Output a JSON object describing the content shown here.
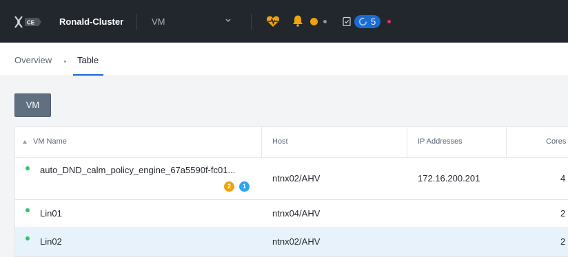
{
  "header": {
    "logo_text": "CE",
    "cluster_name": "Ronald-Cluster",
    "entity_selector": "VM",
    "task_count": "5",
    "colors": {
      "background": "#22272e",
      "health": "#f0a30a",
      "alert": "#f0a30a",
      "task_pill": "#1b6bd3",
      "error_dot": "#e0355a"
    }
  },
  "tabs": [
    {
      "label": "Overview",
      "active": false
    },
    {
      "label": "Table",
      "active": true
    }
  ],
  "vm_button": {
    "label": "VM"
  },
  "table": {
    "columns": [
      "VM Name",
      "Host",
      "IP Addresses",
      "Cores"
    ],
    "rows": [
      {
        "name": "auto_DND_calm_policy_engine_67a5590f-fc01...",
        "host": "ntnx02/AHV",
        "ip": "172.16.200.201",
        "cores": "4",
        "status": "on",
        "badges": [
          {
            "value": "2",
            "color": "#f0a30a"
          },
          {
            "value": "1",
            "color": "#2ea3f2"
          }
        ],
        "selected": false
      },
      {
        "name": "Lin01",
        "host": "ntnx04/AHV",
        "ip": "",
        "cores": "2",
        "status": "on",
        "badges": [],
        "selected": false
      },
      {
        "name": "Lin02",
        "host": "ntnx02/AHV",
        "ip": "",
        "cores": "2",
        "status": "on",
        "badges": [],
        "selected": true
      }
    ]
  }
}
